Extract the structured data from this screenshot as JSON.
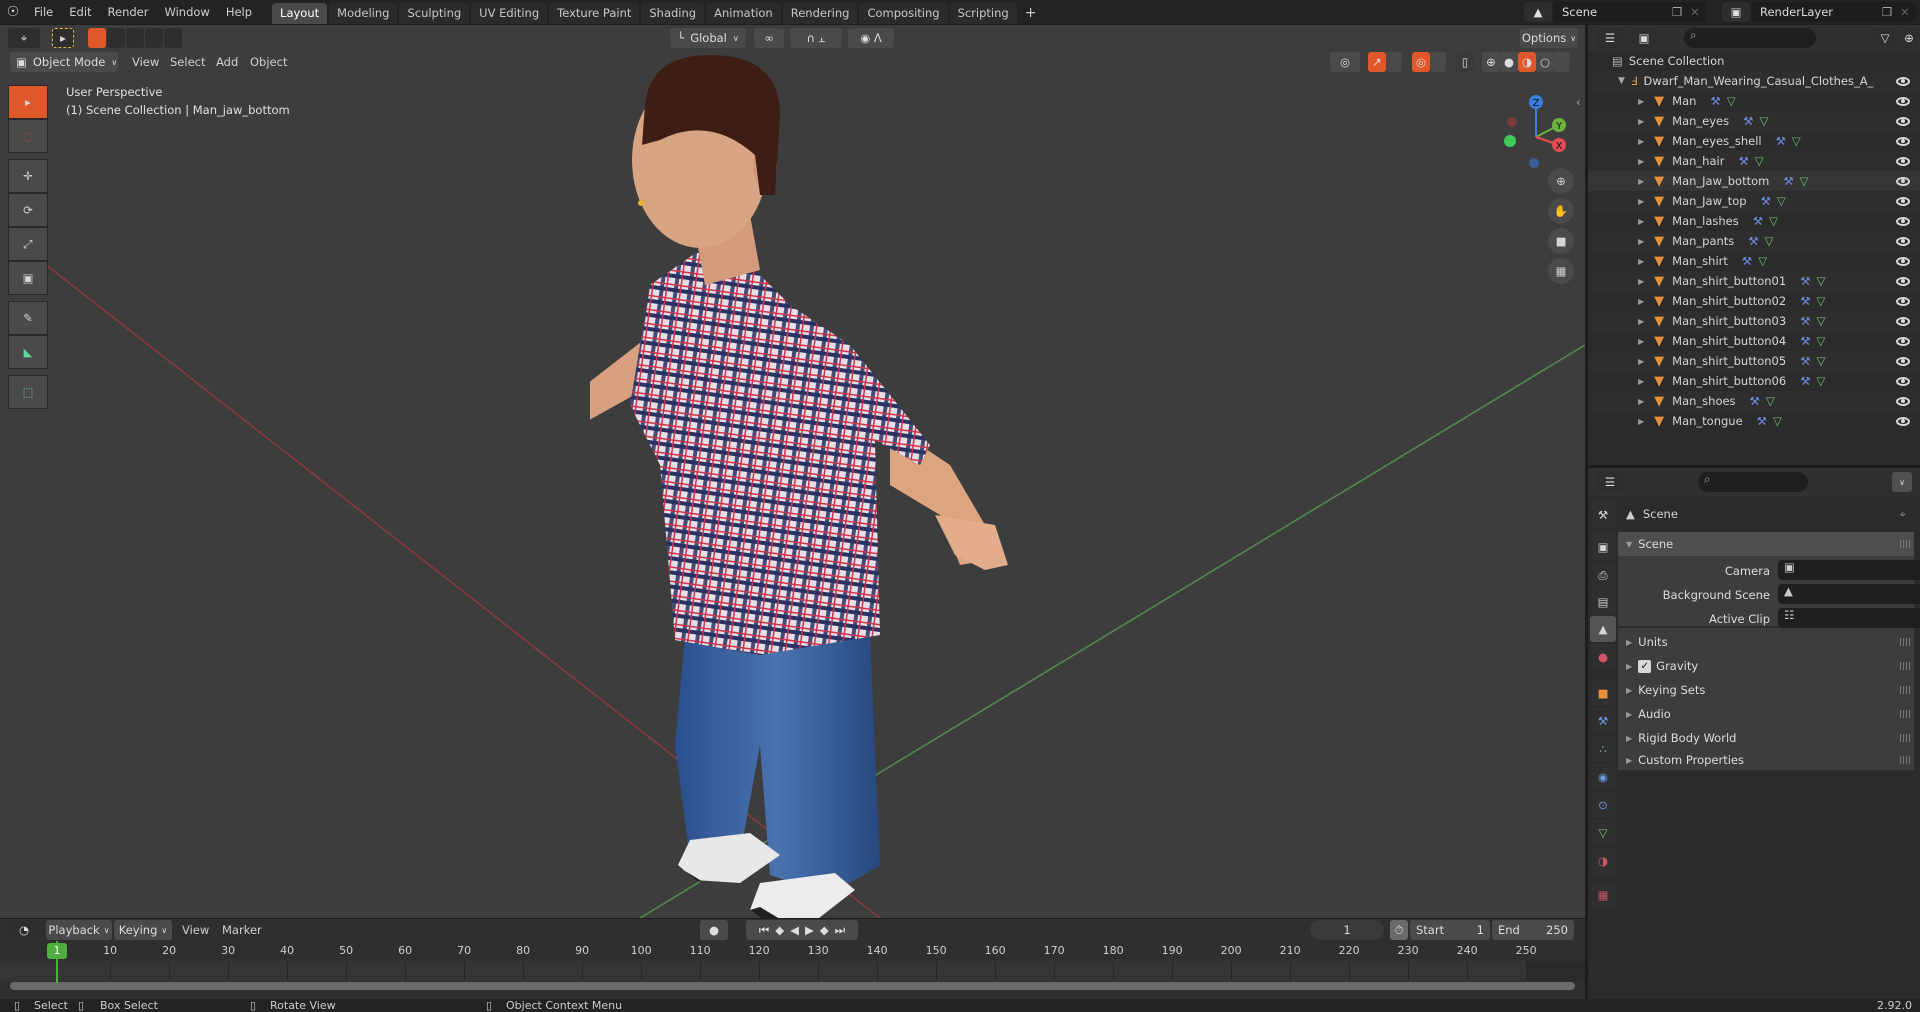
{
  "topbar": {
    "menu": [
      "File",
      "Edit",
      "Render",
      "Window",
      "Help"
    ],
    "workspaces": [
      "Layout",
      "Modeling",
      "Sculpting",
      "UV Editing",
      "Texture Paint",
      "Shading",
      "Animation",
      "Rendering",
      "Compositing",
      "Scripting"
    ],
    "active_workspace": "Layout",
    "add_workspace": "+",
    "scene_name": "Scene",
    "view_layer": "RenderLayer"
  },
  "viewport": {
    "mode": "Object Mode",
    "menu": [
      "View",
      "Select",
      "Add",
      "Object"
    ],
    "transform_orientation": "Global",
    "options_label": "Options",
    "view_name": "User Perspective",
    "active_info": "(1) Scene Collection | Man_jaw_bottom",
    "gizmo_axes": {
      "z": "Z",
      "y": "Y",
      "x": "X"
    },
    "colors": {
      "x_axis": "#e54b54",
      "y_axis": "#6db13e",
      "z_axis": "#3a7fe0",
      "active_tool": "#e0572a"
    }
  },
  "outliner": {
    "root": "Scene Collection",
    "collection": "Dwarf_Man_Wearing_Casual_Clothes_A_pose",
    "objects": [
      "Man",
      "Man_eyes",
      "Man_eyes_shell",
      "Man_hair",
      "Man_Jaw_bottom",
      "Man_Jaw_top",
      "Man_lashes",
      "Man_pants",
      "Man_shirt",
      "Man_shirt_button01",
      "Man_shirt_button02",
      "Man_shirt_button03",
      "Man_shirt_button04",
      "Man_shirt_button05",
      "Man_shirt_button06",
      "Man_shoes",
      "Man_tongue"
    ],
    "selected": "Man_Jaw_bottom"
  },
  "properties": {
    "context": "Scene",
    "panel_title": "Scene",
    "fields": [
      {
        "label": "Camera",
        "value": ""
      },
      {
        "label": "Background Scene",
        "value": ""
      },
      {
        "label": "Active Clip",
        "value": ""
      }
    ],
    "subpanels": [
      "Units",
      "Gravity",
      "Keying Sets",
      "Audio",
      "Rigid Body World",
      "Custom Properties"
    ],
    "gravity_enabled": true
  },
  "timeline": {
    "menu": [
      "Playback",
      "Keying",
      "View",
      "Marker"
    ],
    "current_frame": "1",
    "start_label": "Start",
    "start": "1",
    "end_label": "End",
    "end": "250",
    "ruler": [
      "1",
      "10",
      "20",
      "30",
      "40",
      "50",
      "60",
      "70",
      "80",
      "90",
      "100",
      "110",
      "120",
      "130",
      "140",
      "150",
      "160",
      "170",
      "180",
      "190",
      "200",
      "210",
      "220",
      "230",
      "240",
      "250"
    ]
  },
  "statusbar": {
    "select": "Select",
    "box_select": "Box Select",
    "rotate_view": "Rotate View",
    "context_menu": "Object Context Menu",
    "version": "2.92.0"
  }
}
